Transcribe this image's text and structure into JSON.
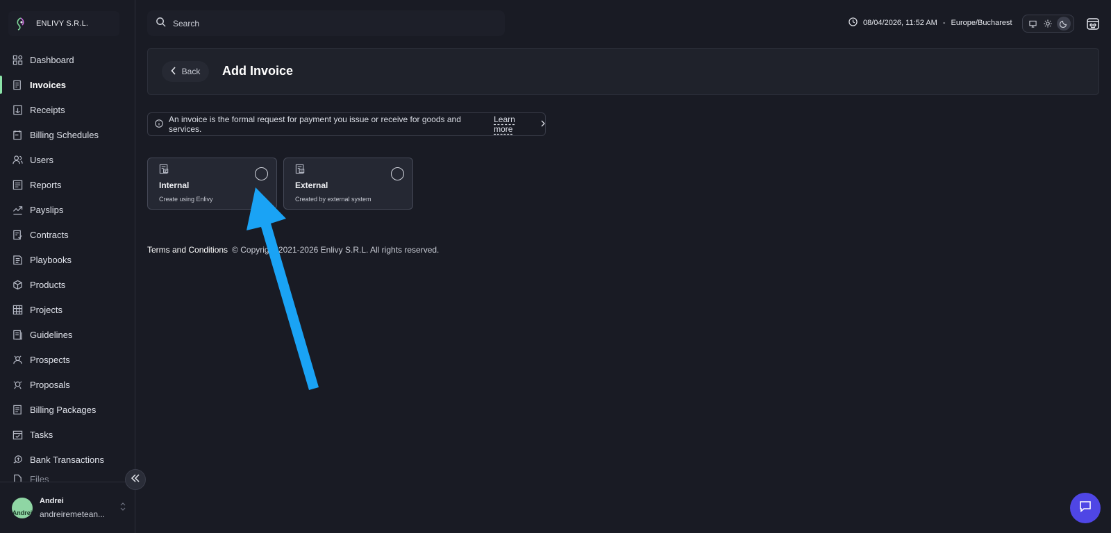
{
  "company": {
    "name": "ENLIVY S.R.L."
  },
  "search": {
    "placeholder": "Search"
  },
  "clock": {
    "datetime": "08/04/2026, 11:52 AM",
    "separator": "-",
    "timezone": "Europe/Bucharest"
  },
  "sidebar": {
    "items": [
      {
        "label": "Dashboard",
        "icon": "dashboard-icon",
        "active": false
      },
      {
        "label": "Invoices",
        "icon": "invoice-icon",
        "active": true
      },
      {
        "label": "Receipts",
        "icon": "receipt-icon",
        "active": false
      },
      {
        "label": "Billing Schedules",
        "icon": "billing-schedule-icon",
        "active": false
      },
      {
        "label": "Users",
        "icon": "users-icon",
        "active": false
      },
      {
        "label": "Reports",
        "icon": "reports-icon",
        "active": false
      },
      {
        "label": "Payslips",
        "icon": "payslips-icon",
        "active": false
      },
      {
        "label": "Contracts",
        "icon": "contracts-icon",
        "active": false
      },
      {
        "label": "Playbooks",
        "icon": "playbooks-icon",
        "active": false
      },
      {
        "label": "Products",
        "icon": "products-icon",
        "active": false
      },
      {
        "label": "Projects",
        "icon": "projects-icon",
        "active": false
      },
      {
        "label": "Guidelines",
        "icon": "guidelines-icon",
        "active": false
      },
      {
        "label": "Prospects",
        "icon": "prospects-icon",
        "active": false
      },
      {
        "label": "Proposals",
        "icon": "proposals-icon",
        "active": false
      },
      {
        "label": "Billing Packages",
        "icon": "billing-packages-icon",
        "active": false
      },
      {
        "label": "Tasks",
        "icon": "tasks-icon",
        "active": false
      },
      {
        "label": "Bank Transactions",
        "icon": "bank-transactions-icon",
        "active": false
      },
      {
        "label": "Files",
        "icon": "files-icon",
        "active": false
      }
    ]
  },
  "user": {
    "name": "Andrei",
    "email": "andreiremetean...",
    "avatar_text": "Andrei"
  },
  "header": {
    "back_label": "Back",
    "title": "Add Invoice"
  },
  "info": {
    "text": "An invoice is the formal request for payment you issue or receive for goods and services.",
    "link_label": "Learn more"
  },
  "options": [
    {
      "title": "Internal",
      "subtitle": "Create using Enlivy"
    },
    {
      "title": "External",
      "subtitle": "Created by external system"
    }
  ],
  "footer": {
    "terms_label": "Terms and Conditions",
    "copyright": "© Copyright 2021-2026 Enlivy S.R.L. All rights reserved."
  },
  "colors": {
    "accent": "#8be3a8",
    "chat": "#4f46e5",
    "annotation_arrow": "#1aa3f5"
  }
}
